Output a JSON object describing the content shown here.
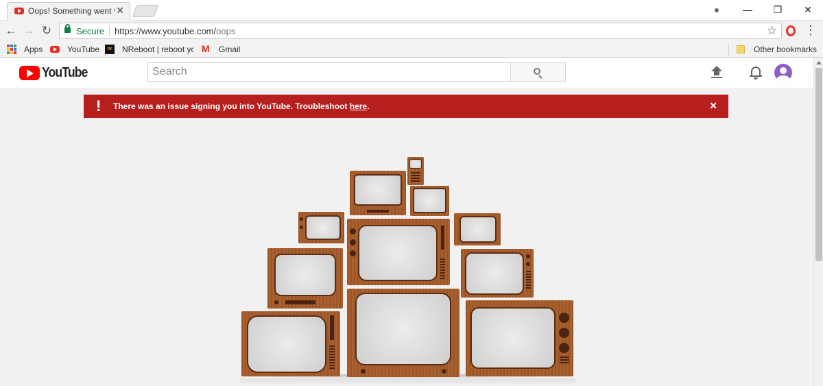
{
  "browser": {
    "tab_title": "Oops! Something went w",
    "tab_close": "✕",
    "window_controls": {
      "minimize": "—",
      "restore": "❐",
      "close": "✕",
      "profile": "●"
    },
    "nav": {
      "back": "←",
      "forward": "→",
      "reload": "↻"
    },
    "omnibox": {
      "security_label": "Secure",
      "url_host": "https://www.youtube.com/",
      "url_path": "oops",
      "star": "☆"
    },
    "menu": "⋮",
    "bookmarks": [
      {
        "label": "Apps",
        "icon": "apps-grid-icon"
      },
      {
        "label": "YouTube",
        "icon": "youtube-icon"
      },
      {
        "label": "NReboot | reboot yo",
        "icon": "nreboot-icon"
      },
      {
        "label": "Gmail",
        "icon": "gmail-icon"
      }
    ],
    "other_bookmarks": "Other bookmarks",
    "nr_badge": "nr",
    "gmail_glyph": "M"
  },
  "youtube": {
    "logo_text": "YouTube",
    "search_placeholder": "Search",
    "icons": [
      "search-icon",
      "upload-icon",
      "notifications-bell-icon",
      "account-avatar"
    ]
  },
  "banner": {
    "icon": "!",
    "message": "There was an issue signing you into YouTube. Troubleshoot ",
    "link": "here",
    "suffix": ".",
    "close": "✕",
    "color": "#b71f1f"
  },
  "colors": {
    "youtube_red": "#ff0000",
    "tv_wood": "#a65a28",
    "page_bg": "#f1f1f1"
  }
}
